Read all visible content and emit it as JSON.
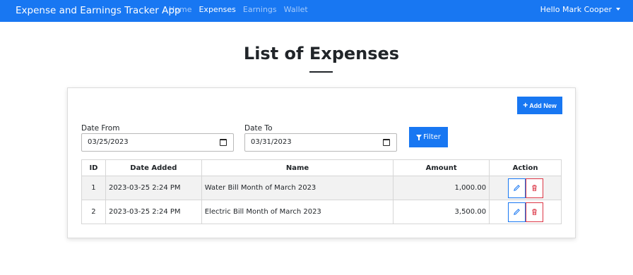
{
  "navbar": {
    "brand": "Expense and Earnings Tracker App",
    "links": [
      {
        "label": "Home",
        "active": false
      },
      {
        "label": "Expenses",
        "active": true
      },
      {
        "label": "Earnings",
        "active": false
      },
      {
        "label": "Wallet",
        "active": false
      }
    ],
    "user": "Hello Mark Cooper",
    "color": "#1877f2"
  },
  "page": {
    "title": "List of Expenses"
  },
  "toolbar": {
    "add_label": "Add New",
    "filter_label": "Filter"
  },
  "filters": {
    "date_from_label": "Date From",
    "date_from_value": "03/25/2023",
    "date_to_label": "Date To",
    "date_to_value": "03/31/2023"
  },
  "table": {
    "headers": [
      "ID",
      "Date Added",
      "Name",
      "Amount",
      "Action"
    ],
    "rows": [
      {
        "id": "1",
        "date": "2023-03-25 2:24 PM",
        "name": "Water Bill Month of March 2023",
        "amount": "1,000.00"
      },
      {
        "id": "2",
        "date": "2023-03-25 2:24 PM",
        "name": "Electric Bill Month of March 2023",
        "amount": "3,500.00"
      }
    ]
  },
  "icons": {
    "add": "plus-icon",
    "filter": "funnel-icon",
    "edit": "pencil-icon",
    "delete": "trash-icon",
    "calendar": "calendar-icon",
    "caret": "caret-down-icon"
  },
  "colors": {
    "primary": "#1877f2",
    "danger": "#dc3545"
  }
}
